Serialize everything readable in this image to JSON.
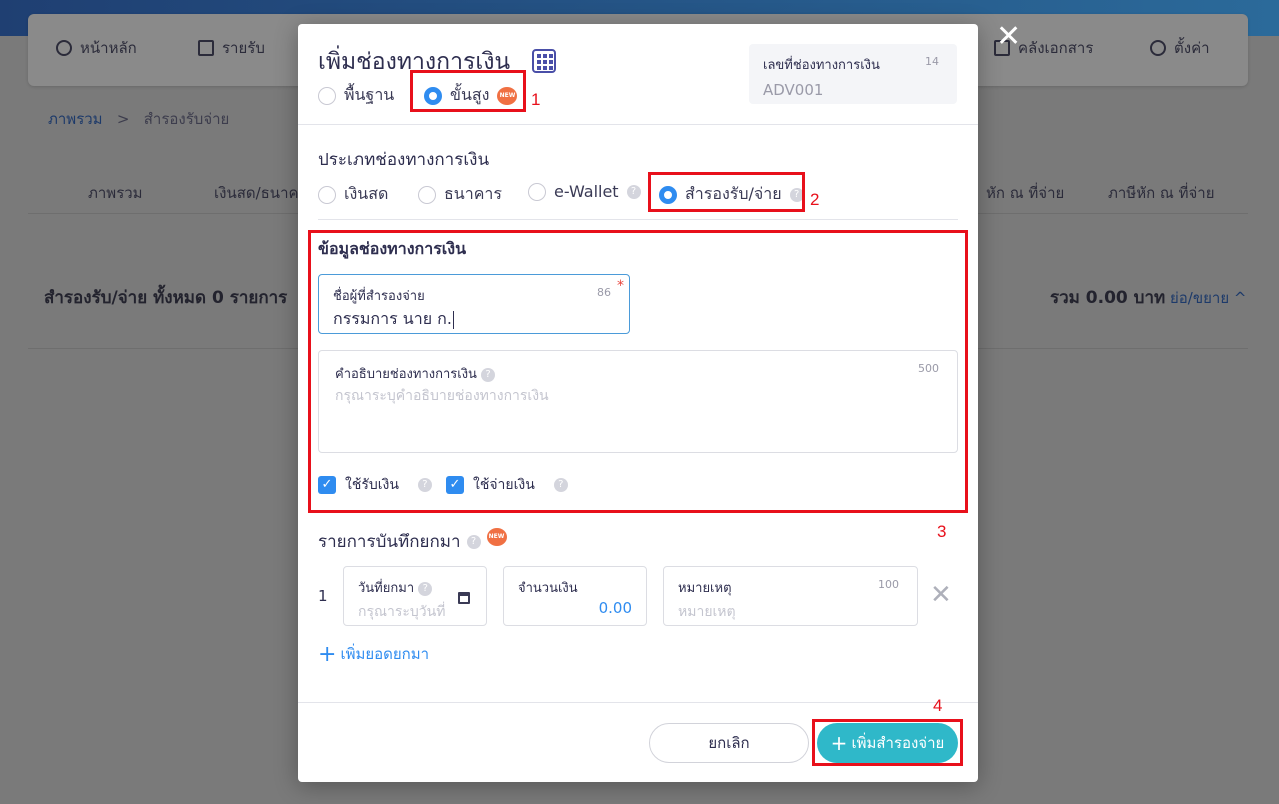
{
  "background": {
    "nav": [
      "หน้าหลัก",
      "รายรับ",
      "คลังเอกสาร",
      "ตั้งค่า"
    ],
    "breadcrumb": {
      "root": "ภาพรวม",
      "separator": ">",
      "current": "สำรองรับจ่าย"
    },
    "tabs": [
      "ภาพรวม",
      "เงินสด/ธนาคา",
      "หัก ณ ที่จ่าย",
      "ภาษีหัก ณ ที่จ่าย"
    ],
    "summary": "สำรองรับ/จ่าย ทั้งหมด 0 รายการ",
    "total": "รวม 0.00 บาท",
    "collapse": "ย่อ/ขยาย ^"
  },
  "modal": {
    "title": "เพิ่มช่องทางการเงิน",
    "mode_options": [
      {
        "label": "พื้นฐาน",
        "selected": false
      },
      {
        "label": "ขั้นสูง",
        "selected": true,
        "badge": "NEW"
      }
    ],
    "doc_number": {
      "label": "เลขที่ช่องทางการเงิน",
      "count": "14",
      "value": "ADV001"
    },
    "channel_type": {
      "title": "ประเภทช่องทางการเงิน",
      "options": [
        {
          "label": "เงินสด",
          "selected": false
        },
        {
          "label": "ธนาคาร",
          "selected": false
        },
        {
          "label": "e-Wallet",
          "selected": false
        },
        {
          "label": "สำรองรับ/จ่าย",
          "selected": true
        }
      ]
    },
    "info": {
      "title": "ข้อมูลช่องทางการเงิน",
      "payer_name": {
        "label": "ชื่อผู้ที่สำรองจ่าย",
        "count": "86",
        "required": "*",
        "value": "กรรมการ นาย ก."
      },
      "description": {
        "label": "คำอธิบายช่องทางการเงิน",
        "count": "500",
        "placeholder": "กรุณาระบุคำอธิบายช่องทางการเงิน"
      },
      "use_receive": {
        "label": "ใช้รับเงิน",
        "checked": true
      },
      "use_pay": {
        "label": "ใช้จ่ายเงิน",
        "checked": true
      }
    },
    "carry_forward": {
      "title": "รายการบันทึกยกมา",
      "badge": "NEW",
      "row": {
        "index": "1",
        "date": {
          "label": "วันที่ยกมา",
          "placeholder": "กรุณาระบุวันที่"
        },
        "amount": {
          "label": "จำนวนเงิน",
          "value": "0.00"
        },
        "note": {
          "label": "หมายเหตุ",
          "count": "100",
          "placeholder": "หมายเหตุ"
        }
      },
      "add_label": "เพิ่มยอดยกมา"
    },
    "buttons": {
      "cancel": "ยกเลิก",
      "submit": "เพิ่มสำรองจ่าย"
    }
  },
  "annotations": [
    "1",
    "2",
    "3",
    "4"
  ],
  "colors": {
    "accent": "#2f8cf0",
    "submit": "#2fb8c9",
    "annotation": "#e8101b",
    "badge": "#f07043"
  }
}
